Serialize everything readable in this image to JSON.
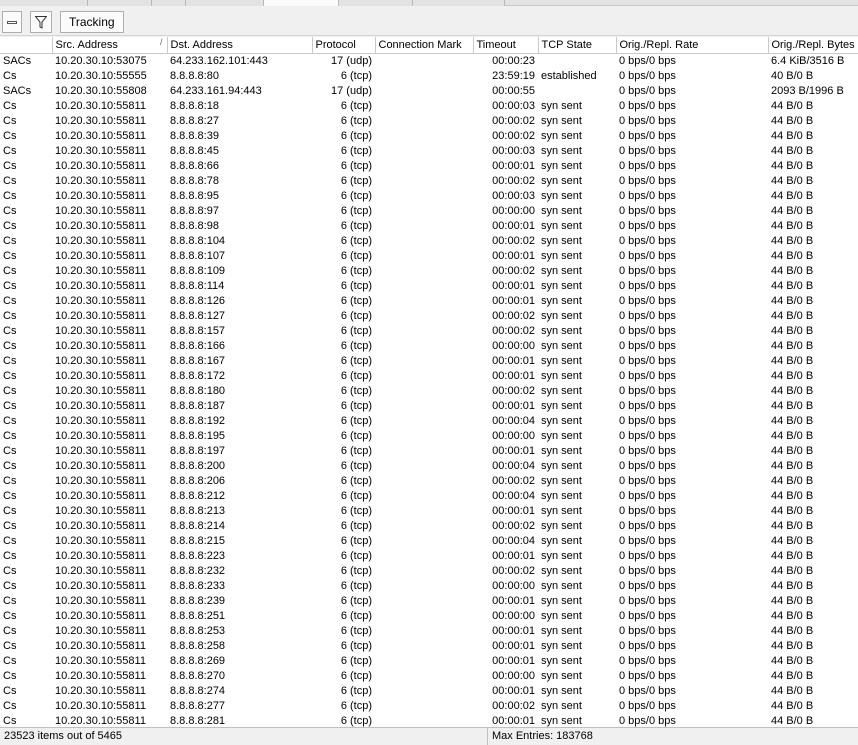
{
  "toolbar": {
    "minus_button_icon": "minus-icon",
    "filter_button_icon": "filter-funnel-icon",
    "tracking_label": "Tracking"
  },
  "columns": [
    "",
    "Src. Address",
    "Dst. Address",
    "Protocol",
    "Connection Mark",
    "Timeout",
    "TCP State",
    "Orig./Repl. Rate",
    "Orig./Repl. Bytes"
  ],
  "rows": [
    [
      "SACs",
      "10.20.30.10:53075",
      "64.233.162.101:443",
      "17 (udp)",
      "",
      "00:00:23",
      "",
      "0 bps/0 bps",
      "6.4 KiB/3516 B"
    ],
    [
      "Cs",
      "10.20.30.10:55555",
      "8.8.8.8:80",
      "6 (tcp)",
      "",
      "23:59:19",
      "established",
      "0 bps/0 bps",
      "40 B/0 B"
    ],
    [
      "SACs",
      "10.20.30.10:55808",
      "64.233.161.94:443",
      "17 (udp)",
      "",
      "00:00:55",
      "",
      "0 bps/0 bps",
      "2093 B/1996 B"
    ],
    [
      "Cs",
      "10.20.30.10:55811",
      "8.8.8.8:18",
      "6 (tcp)",
      "",
      "00:00:03",
      "syn sent",
      "0 bps/0 bps",
      "44 B/0 B"
    ],
    [
      "Cs",
      "10.20.30.10:55811",
      "8.8.8.8:27",
      "6 (tcp)",
      "",
      "00:00:02",
      "syn sent",
      "0 bps/0 bps",
      "44 B/0 B"
    ],
    [
      "Cs",
      "10.20.30.10:55811",
      "8.8.8.8:39",
      "6 (tcp)",
      "",
      "00:00:02",
      "syn sent",
      "0 bps/0 bps",
      "44 B/0 B"
    ],
    [
      "Cs",
      "10.20.30.10:55811",
      "8.8.8.8:45",
      "6 (tcp)",
      "",
      "00:00:03",
      "syn sent",
      "0 bps/0 bps",
      "44 B/0 B"
    ],
    [
      "Cs",
      "10.20.30.10:55811",
      "8.8.8.8:66",
      "6 (tcp)",
      "",
      "00:00:01",
      "syn sent",
      "0 bps/0 bps",
      "44 B/0 B"
    ],
    [
      "Cs",
      "10.20.30.10:55811",
      "8.8.8.8:78",
      "6 (tcp)",
      "",
      "00:00:02",
      "syn sent",
      "0 bps/0 bps",
      "44 B/0 B"
    ],
    [
      "Cs",
      "10.20.30.10:55811",
      "8.8.8.8:95",
      "6 (tcp)",
      "",
      "00:00:03",
      "syn sent",
      "0 bps/0 bps",
      "44 B/0 B"
    ],
    [
      "Cs",
      "10.20.30.10:55811",
      "8.8.8.8:97",
      "6 (tcp)",
      "",
      "00:00:00",
      "syn sent",
      "0 bps/0 bps",
      "44 B/0 B"
    ],
    [
      "Cs",
      "10.20.30.10:55811",
      "8.8.8.8:98",
      "6 (tcp)",
      "",
      "00:00:01",
      "syn sent",
      "0 bps/0 bps",
      "44 B/0 B"
    ],
    [
      "Cs",
      "10.20.30.10:55811",
      "8.8.8.8:104",
      "6 (tcp)",
      "",
      "00:00:02",
      "syn sent",
      "0 bps/0 bps",
      "44 B/0 B"
    ],
    [
      "Cs",
      "10.20.30.10:55811",
      "8.8.8.8:107",
      "6 (tcp)",
      "",
      "00:00:01",
      "syn sent",
      "0 bps/0 bps",
      "44 B/0 B"
    ],
    [
      "Cs",
      "10.20.30.10:55811",
      "8.8.8.8:109",
      "6 (tcp)",
      "",
      "00:00:02",
      "syn sent",
      "0 bps/0 bps",
      "44 B/0 B"
    ],
    [
      "Cs",
      "10.20.30.10:55811",
      "8.8.8.8:114",
      "6 (tcp)",
      "",
      "00:00:01",
      "syn sent",
      "0 bps/0 bps",
      "44 B/0 B"
    ],
    [
      "Cs",
      "10.20.30.10:55811",
      "8.8.8.8:126",
      "6 (tcp)",
      "",
      "00:00:01",
      "syn sent",
      "0 bps/0 bps",
      "44 B/0 B"
    ],
    [
      "Cs",
      "10.20.30.10:55811",
      "8.8.8.8:127",
      "6 (tcp)",
      "",
      "00:00:02",
      "syn sent",
      "0 bps/0 bps",
      "44 B/0 B"
    ],
    [
      "Cs",
      "10.20.30.10:55811",
      "8.8.8.8:157",
      "6 (tcp)",
      "",
      "00:00:02",
      "syn sent",
      "0 bps/0 bps",
      "44 B/0 B"
    ],
    [
      "Cs",
      "10.20.30.10:55811",
      "8.8.8.8:166",
      "6 (tcp)",
      "",
      "00:00:00",
      "syn sent",
      "0 bps/0 bps",
      "44 B/0 B"
    ],
    [
      "Cs",
      "10.20.30.10:55811",
      "8.8.8.8:167",
      "6 (tcp)",
      "",
      "00:00:01",
      "syn sent",
      "0 bps/0 bps",
      "44 B/0 B"
    ],
    [
      "Cs",
      "10.20.30.10:55811",
      "8.8.8.8:172",
      "6 (tcp)",
      "",
      "00:00:01",
      "syn sent",
      "0 bps/0 bps",
      "44 B/0 B"
    ],
    [
      "Cs",
      "10.20.30.10:55811",
      "8.8.8.8:180",
      "6 (tcp)",
      "",
      "00:00:02",
      "syn sent",
      "0 bps/0 bps",
      "44 B/0 B"
    ],
    [
      "Cs",
      "10.20.30.10:55811",
      "8.8.8.8:187",
      "6 (tcp)",
      "",
      "00:00:01",
      "syn sent",
      "0 bps/0 bps",
      "44 B/0 B"
    ],
    [
      "Cs",
      "10.20.30.10:55811",
      "8.8.8.8:192",
      "6 (tcp)",
      "",
      "00:00:04",
      "syn sent",
      "0 bps/0 bps",
      "44 B/0 B"
    ],
    [
      "Cs",
      "10.20.30.10:55811",
      "8.8.8.8:195",
      "6 (tcp)",
      "",
      "00:00:00",
      "syn sent",
      "0 bps/0 bps",
      "44 B/0 B"
    ],
    [
      "Cs",
      "10.20.30.10:55811",
      "8.8.8.8:197",
      "6 (tcp)",
      "",
      "00:00:01",
      "syn sent",
      "0 bps/0 bps",
      "44 B/0 B"
    ],
    [
      "Cs",
      "10.20.30.10:55811",
      "8.8.8.8:200",
      "6 (tcp)",
      "",
      "00:00:04",
      "syn sent",
      "0 bps/0 bps",
      "44 B/0 B"
    ],
    [
      "Cs",
      "10.20.30.10:55811",
      "8.8.8.8:206",
      "6 (tcp)",
      "",
      "00:00:02",
      "syn sent",
      "0 bps/0 bps",
      "44 B/0 B"
    ],
    [
      "Cs",
      "10.20.30.10:55811",
      "8.8.8.8:212",
      "6 (tcp)",
      "",
      "00:00:04",
      "syn sent",
      "0 bps/0 bps",
      "44 B/0 B"
    ],
    [
      "Cs",
      "10.20.30.10:55811",
      "8.8.8.8:213",
      "6 (tcp)",
      "",
      "00:00:01",
      "syn sent",
      "0 bps/0 bps",
      "44 B/0 B"
    ],
    [
      "Cs",
      "10.20.30.10:55811",
      "8.8.8.8:214",
      "6 (tcp)",
      "",
      "00:00:02",
      "syn sent",
      "0 bps/0 bps",
      "44 B/0 B"
    ],
    [
      "Cs",
      "10.20.30.10:55811",
      "8.8.8.8:215",
      "6 (tcp)",
      "",
      "00:00:04",
      "syn sent",
      "0 bps/0 bps",
      "44 B/0 B"
    ],
    [
      "Cs",
      "10.20.30.10:55811",
      "8.8.8.8:223",
      "6 (tcp)",
      "",
      "00:00:01",
      "syn sent",
      "0 bps/0 bps",
      "44 B/0 B"
    ],
    [
      "Cs",
      "10.20.30.10:55811",
      "8.8.8.8:232",
      "6 (tcp)",
      "",
      "00:00:02",
      "syn sent",
      "0 bps/0 bps",
      "44 B/0 B"
    ],
    [
      "Cs",
      "10.20.30.10:55811",
      "8.8.8.8:233",
      "6 (tcp)",
      "",
      "00:00:00",
      "syn sent",
      "0 bps/0 bps",
      "44 B/0 B"
    ],
    [
      "Cs",
      "10.20.30.10:55811",
      "8.8.8.8:239",
      "6 (tcp)",
      "",
      "00:00:01",
      "syn sent",
      "0 bps/0 bps",
      "44 B/0 B"
    ],
    [
      "Cs",
      "10.20.30.10:55811",
      "8.8.8.8:251",
      "6 (tcp)",
      "",
      "00:00:00",
      "syn sent",
      "0 bps/0 bps",
      "44 B/0 B"
    ],
    [
      "Cs",
      "10.20.30.10:55811",
      "8.8.8.8:253",
      "6 (tcp)",
      "",
      "00:00:01",
      "syn sent",
      "0 bps/0 bps",
      "44 B/0 B"
    ],
    [
      "Cs",
      "10.20.30.10:55811",
      "8.8.8.8:258",
      "6 (tcp)",
      "",
      "00:00:01",
      "syn sent",
      "0 bps/0 bps",
      "44 B/0 B"
    ],
    [
      "Cs",
      "10.20.30.10:55811",
      "8.8.8.8:269",
      "6 (tcp)",
      "",
      "00:00:01",
      "syn sent",
      "0 bps/0 bps",
      "44 B/0 B"
    ],
    [
      "Cs",
      "10.20.30.10:55811",
      "8.8.8.8:270",
      "6 (tcp)",
      "",
      "00:00:00",
      "syn sent",
      "0 bps/0 bps",
      "44 B/0 B"
    ],
    [
      "Cs",
      "10.20.30.10:55811",
      "8.8.8.8:274",
      "6 (tcp)",
      "",
      "00:00:01",
      "syn sent",
      "0 bps/0 bps",
      "44 B/0 B"
    ],
    [
      "Cs",
      "10.20.30.10:55811",
      "8.8.8.8:277",
      "6 (tcp)",
      "",
      "00:00:02",
      "syn sent",
      "0 bps/0 bps",
      "44 B/0 B"
    ],
    [
      "Cs",
      "10.20.30.10:55811",
      "8.8.8.8:281",
      "6 (tcp)",
      "",
      "00:00:01",
      "syn sent",
      "0 bps/0 bps",
      "44 B/0 B"
    ]
  ],
  "status": {
    "items_text": "23523 items out of 5465",
    "max_entries_text": "Max Entries: 183768"
  }
}
